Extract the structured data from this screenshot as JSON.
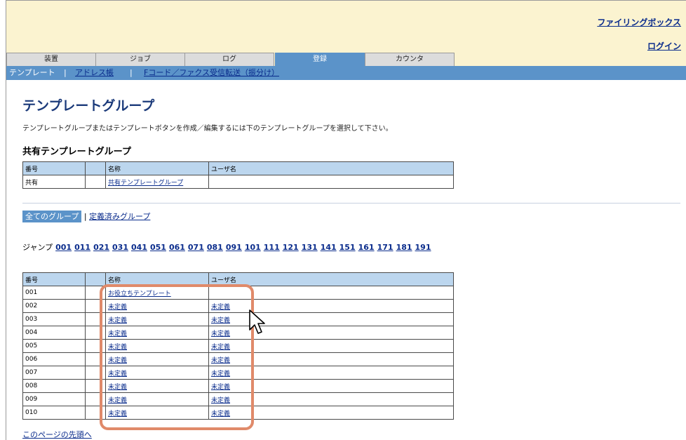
{
  "header": {
    "filing_box_link": "ファイリングボックス",
    "login_link": "ログイン"
  },
  "tabs": [
    "装置",
    "ジョブ",
    "ログ",
    "登録",
    "カウンタ"
  ],
  "subnav": {
    "current": "テンプレート",
    "sep": "|",
    "address_book": "アドレス帳",
    "fcode": "Fコード／ファクス受信転送（振分け）"
  },
  "page": {
    "title": "テンプレートグループ",
    "description": "テンプレートグループまたはテンプレートボタンを作成／編集するには下のテンプレートグループを選択して下さい。",
    "shared_section_title": "共有テンプレートグループ"
  },
  "shared_table": {
    "headers": [
      "番号",
      "",
      "名称",
      "ユーザ名"
    ],
    "row": {
      "number": "共有",
      "name": "共有テンプレートグループ",
      "user": ""
    }
  },
  "filter": {
    "all_label": "全てのグループ",
    "separator": "|",
    "defined_label": "定義済みグループ"
  },
  "jump": {
    "label": "ジャンプ",
    "links": [
      "001",
      "011",
      "021",
      "031",
      "041",
      "051",
      "061",
      "071",
      "081",
      "091",
      "101",
      "111",
      "121",
      "131",
      "141",
      "151",
      "161",
      "171",
      "181",
      "191"
    ]
  },
  "groups_table": {
    "headers": [
      "番号",
      "",
      "名称",
      "ユーザ名"
    ],
    "rows": [
      {
        "number": "001",
        "name": "お役立ちテンプレート",
        "user": ""
      },
      {
        "number": "002",
        "name": "未定義",
        "user": "未定義"
      },
      {
        "number": "003",
        "name": "未定義",
        "user": "未定義"
      },
      {
        "number": "004",
        "name": "未定義",
        "user": "未定義"
      },
      {
        "number": "005",
        "name": "未定義",
        "user": "未定義"
      },
      {
        "number": "006",
        "name": "未定義",
        "user": "未定義"
      },
      {
        "number": "007",
        "name": "未定義",
        "user": "未定義"
      },
      {
        "number": "008",
        "name": "未定義",
        "user": "未定義"
      },
      {
        "number": "009",
        "name": "未定義",
        "user": "未定義"
      },
      {
        "number": "010",
        "name": "未定義",
        "user": "未定義"
      }
    ]
  },
  "footer": {
    "back_to_top": "このページの先頭へ"
  },
  "colors": {
    "tab_active": "#5b93c9",
    "header_bg": "#fbf3d0",
    "table_header": "#bcd6ee",
    "highlight": "#e08a6a",
    "link": "#0a2c8c"
  }
}
